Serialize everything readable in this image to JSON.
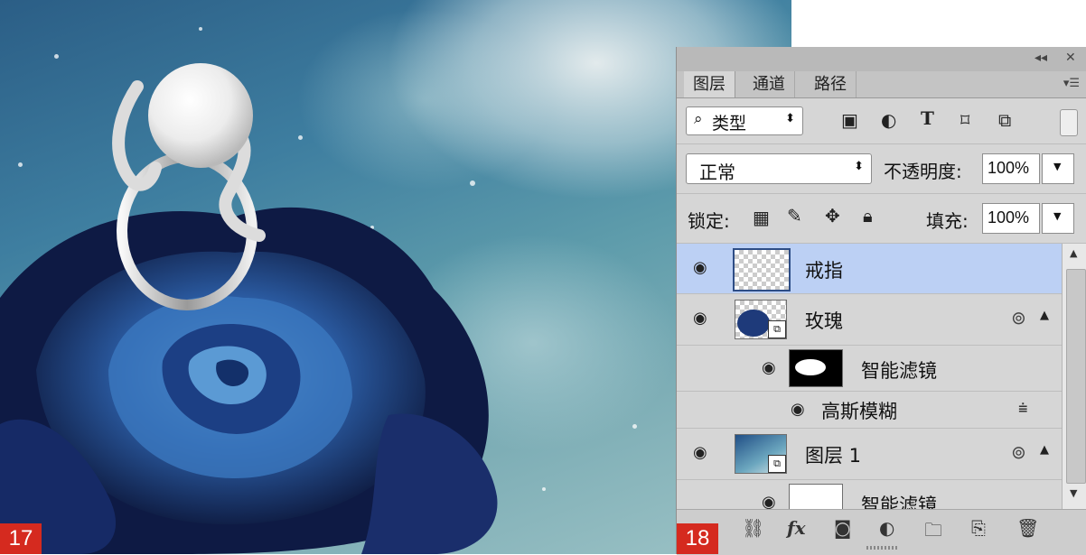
{
  "figure": {
    "left_label": "17",
    "right_label": "18"
  },
  "panel": {
    "collapse_icon": "double-chevron-icon",
    "close_icon": "close-icon",
    "tabs": [
      {
        "label": "图层",
        "active": true
      },
      {
        "label": "通道",
        "active": false
      },
      {
        "label": "路径",
        "active": false
      }
    ],
    "filter": {
      "kind_label": "类型",
      "icons": [
        "image-filter-icon",
        "adjustment-filter-icon",
        "type-filter-icon",
        "shape-filter-icon",
        "smart-object-filter-icon"
      ],
      "type_glyph": "T"
    },
    "blend": {
      "mode": "正常",
      "opacity_label": "不透明度:",
      "opacity_value": "100%"
    },
    "lock": {
      "label": "锁定:",
      "fill_label": "填充:",
      "fill_value": "100%"
    },
    "layers": [
      {
        "name": "戒指",
        "type": "layer",
        "selected": true
      },
      {
        "name": "玫瑰",
        "type": "smart-object",
        "selected": false
      },
      {
        "name": "智能滤镜",
        "type": "smart-filter-mask",
        "selected": false
      },
      {
        "name": "高斯模糊",
        "type": "filter",
        "selected": false
      },
      {
        "name": "图层 1",
        "type": "smart-object",
        "selected": false
      },
      {
        "name": "智能滤镜",
        "type": "smart-filter-mask",
        "selected": false
      }
    ],
    "bottom_icons": [
      "link-icon",
      "fx-icon",
      "mask-icon",
      "adjustment-icon",
      "folder-icon",
      "new-layer-icon",
      "trash-icon"
    ],
    "fx_label": "fx"
  },
  "colors": {
    "selected_layer": "#bcd0f4",
    "badge": "#d52a1f",
    "panel_bg": "#d6d6d6"
  }
}
